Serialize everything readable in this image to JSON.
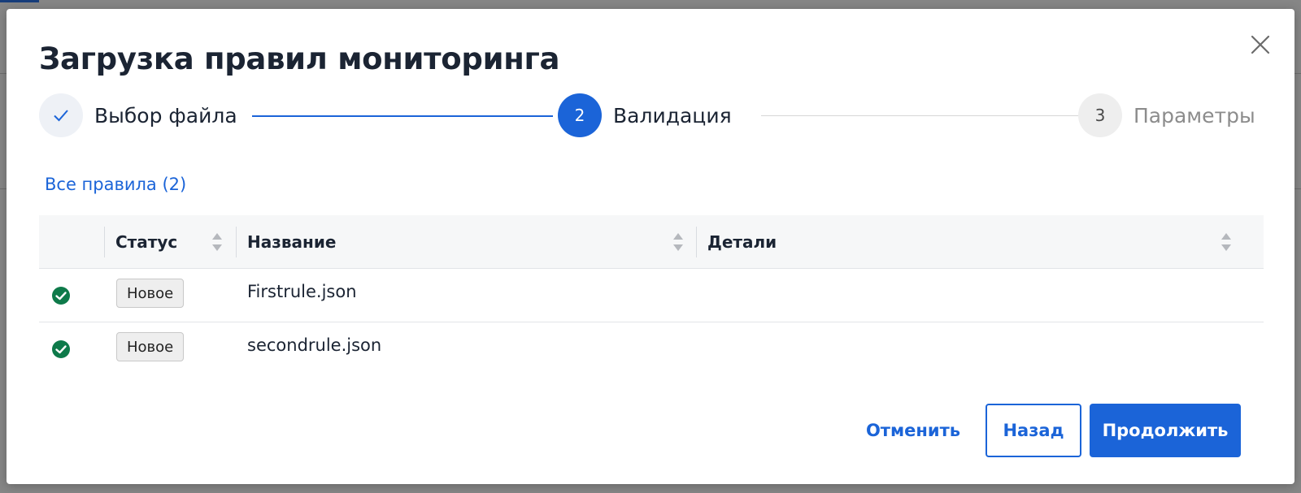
{
  "modal": {
    "title": "Загрузка правил мониторинга"
  },
  "stepper": {
    "steps": [
      {
        "number": "",
        "label": "Выбор файла",
        "state": "done"
      },
      {
        "number": "2",
        "label": "Валидация",
        "state": "active"
      },
      {
        "number": "3",
        "label": "Параметры",
        "state": "pending"
      }
    ]
  },
  "filter": {
    "all_rules_label": "Все правила (2)"
  },
  "table": {
    "columns": [
      "Статус",
      "Название",
      "Детали"
    ],
    "rows": [
      {
        "status": "Новое",
        "name": "Firstrule.json",
        "details": ""
      },
      {
        "status": "Новое",
        "name": "secondrule.json",
        "details": ""
      }
    ]
  },
  "footer": {
    "cancel_label": "Отменить",
    "back_label": "Назад",
    "continue_label": "Продолжить"
  },
  "colors": {
    "accent": "#1b64d8",
    "success": "#0e7a4a"
  }
}
